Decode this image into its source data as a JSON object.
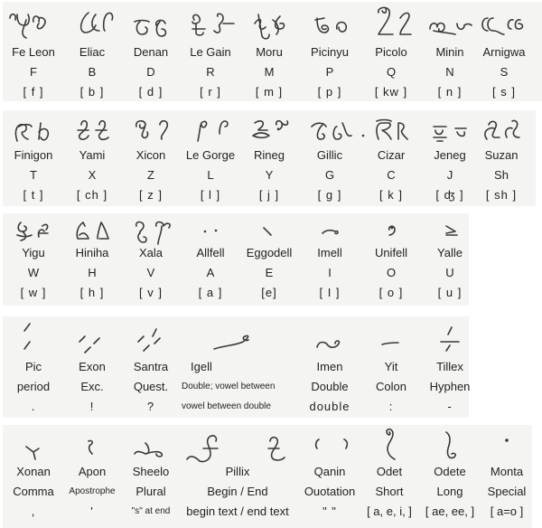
{
  "rows": [
    {
      "id": "consonants-1",
      "items": [
        {
          "name": "Fe Leon",
          "letter": "F",
          "sound": "[ f ]",
          "glyph": "fe-leon-glyph"
        },
        {
          "name": "Eliac",
          "letter": "B",
          "sound": "[ b ]",
          "glyph": "eliac-glyph"
        },
        {
          "name": "Denan",
          "letter": "D",
          "sound": "[ d ]",
          "glyph": "denan-glyph"
        },
        {
          "name": "Le Gain",
          "letter": "R",
          "sound": "[ r ]",
          "glyph": "le-gain-glyph"
        },
        {
          "name": "Moru",
          "letter": "M",
          "sound": "[ m ]",
          "glyph": "moru-glyph"
        },
        {
          "name": "Picinyu",
          "letter": "P",
          "sound": "[ p ]",
          "glyph": "picinyu-glyph"
        },
        {
          "name": "Picolo",
          "letter": "Q",
          "sound": "[ kw ]",
          "glyph": "picolo-glyph"
        },
        {
          "name": "Minin",
          "letter": "N",
          "sound": "[ n ]",
          "glyph": "minin-glyph"
        },
        {
          "name": "Arnigwa",
          "letter": "S",
          "sound": "[ s ]",
          "glyph": "arnigwa-glyph"
        }
      ]
    },
    {
      "id": "consonants-2",
      "items": [
        {
          "name": "Finigon",
          "letter": "T",
          "sound": "[ t ]",
          "glyph": "finigon-glyph"
        },
        {
          "name": "Yami",
          "letter": "X",
          "sound": "[ ch ]",
          "glyph": "yami-glyph"
        },
        {
          "name": "Xicon",
          "letter": "Z",
          "sound": "[ z ]",
          "glyph": "xicon-glyph"
        },
        {
          "name": "Le Gorge",
          "letter": "L",
          "sound": "[ l ]",
          "glyph": "le-gorge-glyph"
        },
        {
          "name": "Rineg",
          "letter": "Y",
          "sound": "[ j ]",
          "glyph": "rineg-glyph"
        },
        {
          "name": "Gillic",
          "letter": "G",
          "sound": "[ g ]",
          "glyph": "gillic-glyph"
        },
        {
          "name": "Cizar",
          "letter": "C",
          "sound": "[ k ]",
          "glyph": "cizar-glyph"
        },
        {
          "name": "Jeneg",
          "letter": "J",
          "sound": "[ ʤ ]",
          "glyph": "jeneg-glyph"
        },
        {
          "name": "Suzan",
          "letter": "Sh",
          "sound": "[ sh ]",
          "glyph": "suzan-glyph"
        }
      ]
    },
    {
      "id": "consonants-vowels",
      "items": [
        {
          "name": "Yigu",
          "letter": "W",
          "sound": "[ w ]",
          "glyph": "yigu-glyph"
        },
        {
          "name": "Hiniha",
          "letter": "H",
          "sound": "[ h ]",
          "glyph": "hiniha-glyph"
        },
        {
          "name": "Xala",
          "letter": "V",
          "sound": "[ v ]",
          "glyph": "xala-glyph"
        },
        {
          "name": "Allfell",
          "letter": "A",
          "sound": "[ a ]",
          "glyph": "allfell-glyph"
        },
        {
          "name": "Eggodell",
          "letter": "E",
          "sound": "[e]",
          "glyph": "eggodell-glyph"
        },
        {
          "name": "Imell",
          "letter": "I",
          "sound": "[ I ]",
          "glyph": "imell-glyph"
        },
        {
          "name": "Unifell",
          "letter": "O",
          "sound": "[ o ]",
          "glyph": "unifell-glyph"
        },
        {
          "name": "Yalle",
          "letter": "U",
          "sound": "[ u ]",
          "glyph": "yalle-glyph"
        }
      ]
    },
    {
      "id": "punctuation-1",
      "items": [
        {
          "name": "Pic",
          "meaning": "period",
          "symbol": ".",
          "glyph": "pic-glyph"
        },
        {
          "name": "Exon",
          "meaning": "Exc.",
          "symbol": "!",
          "glyph": "exon-glyph"
        },
        {
          "name": "Santra",
          "meaning": "Quest.",
          "symbol": "?",
          "glyph": "santra-glyph"
        },
        {
          "name": "Igell",
          "meaning": "Double; vowel between",
          "symbol": "vowel between double",
          "glyph": "igell-glyph"
        },
        {
          "name": "Imen",
          "meaning": "Double",
          "symbol": "double",
          "glyph": "imen-glyph"
        },
        {
          "name": "Yit",
          "meaning": "Colon",
          "symbol": ":",
          "glyph": "yit-glyph"
        },
        {
          "name": "Tillex",
          "meaning": "Hyphen",
          "symbol": "-",
          "glyph": "tillex-glyph"
        }
      ]
    },
    {
      "id": "punctuation-2",
      "items": [
        {
          "name": "Xonan",
          "meaning": "Comma",
          "symbol": ",",
          "glyph": "xonan-glyph"
        },
        {
          "name": "Apon",
          "meaning": "Apostrophe",
          "symbol": "'",
          "glyph": "apon-glyph"
        },
        {
          "name": "Sheelo",
          "meaning": "Plural",
          "symbol": "\"s\" at end",
          "glyph": "sheelo-glyph"
        },
        {
          "name": "Pillix",
          "meaning": "Begin / End",
          "symbol": "begin text / end text",
          "glyph": "pillix-glyph"
        },
        {
          "name": "Qanin",
          "meaning": "Ouotation",
          "symbol": "\"  \"",
          "glyph": "qanin-glyph"
        },
        {
          "name": "Odet",
          "meaning": "Short",
          "symbol": "[ a, e, i, ]",
          "glyph": "odet-glyph"
        },
        {
          "name": "Odete",
          "meaning": "Long",
          "symbol": "[ ae, ee, ]",
          "glyph": "odete-glyph"
        },
        {
          "name": "Monta",
          "meaning": "Special",
          "symbol": "[ a=o ]",
          "glyph": "monta-glyph"
        }
      ]
    }
  ]
}
